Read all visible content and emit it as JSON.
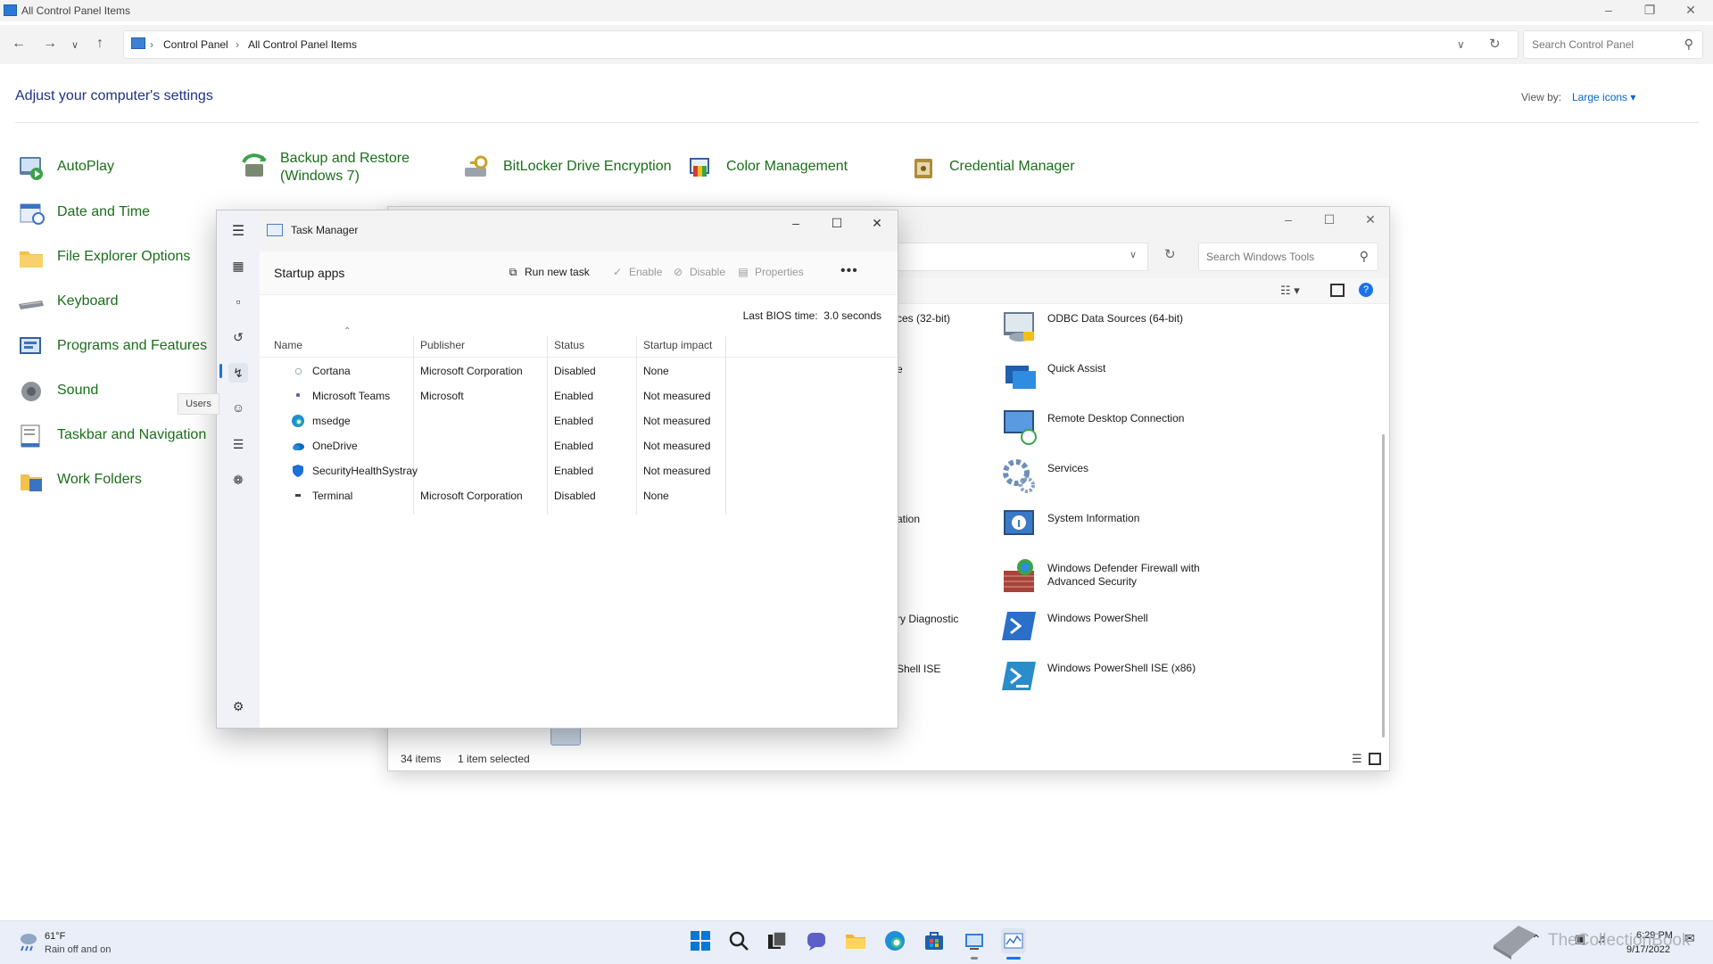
{
  "control_panel": {
    "window_title": "All Control Panel Items",
    "breadcrumb": [
      "Control Panel",
      "All Control Panel Items"
    ],
    "search_placeholder": "Search Control Panel",
    "heading": "Adjust your computer's settings",
    "view_by_label": "View by:",
    "view_by_value": "Large icons",
    "items": [
      {
        "label": "AutoPlay",
        "icon": "autoplay-icon"
      },
      {
        "label": "Backup and Restore (Windows 7)",
        "icon": "backup-icon"
      },
      {
        "label": "BitLocker Drive Encryption",
        "icon": "bitlocker-icon"
      },
      {
        "label": "Color Management",
        "icon": "color-management-icon"
      },
      {
        "label": "Credential Manager",
        "icon": "credential-manager-icon"
      },
      {
        "label": "Date and Time",
        "icon": "date-time-icon"
      },
      {
        "label": "File Explorer Options",
        "icon": "folder-options-icon"
      },
      {
        "label": "Keyboard",
        "icon": "keyboard-icon"
      },
      {
        "label": "Programs and Features",
        "icon": "programs-icon"
      },
      {
        "label": "Sound",
        "icon": "sound-icon"
      },
      {
        "label": "Taskbar and Navigation",
        "icon": "taskbar-icon"
      },
      {
        "label": "Work Folders",
        "icon": "work-folders-icon"
      }
    ]
  },
  "windows_tools": {
    "search_placeholder": "Search Windows Tools",
    "items": [
      {
        "label": "ODBC Data Sources (64-bit)",
        "icon": "odbc-icon"
      },
      {
        "label": "Quick Assist",
        "icon": "quick-assist-icon"
      },
      {
        "label": "Remote Desktop Connection",
        "icon": "remote-desktop-icon"
      },
      {
        "label": "Services",
        "icon": "services-icon"
      },
      {
        "label": "System Information",
        "icon": "system-info-icon"
      },
      {
        "label": "Windows Defender Firewall with Advanced Security",
        "icon": "firewall-icon"
      },
      {
        "label": "Windows PowerShell",
        "icon": "powershell-icon"
      },
      {
        "label": "Windows PowerShell ISE (x86)",
        "icon": "powershell-ise-icon"
      }
    ],
    "partial_left": [
      "ces (32-bit)",
      "e",
      "ation",
      "ry Diagnostic",
      "Shell ISE"
    ],
    "status_count": "34 items",
    "status_selected": "1 item selected"
  },
  "task_manager": {
    "title": "Task Manager",
    "page_title": "Startup apps",
    "toolbar": {
      "run_new_task": "Run new task",
      "enable": "Enable",
      "disable": "Disable",
      "properties": "Properties"
    },
    "bios_label": "Last BIOS time:",
    "bios_value": "3.0 seconds",
    "columns": [
      "Name",
      "Publisher",
      "Status",
      "Startup impact"
    ],
    "rows": [
      {
        "name": "Cortana",
        "publisher": "Microsoft Corporation",
        "status": "Disabled",
        "impact": "None"
      },
      {
        "name": "Microsoft Teams",
        "publisher": "Microsoft",
        "status": "Enabled",
        "impact": "Not measured"
      },
      {
        "name": "msedge",
        "publisher": "",
        "status": "Enabled",
        "impact": "Not measured"
      },
      {
        "name": "OneDrive",
        "publisher": "",
        "status": "Enabled",
        "impact": "Not measured"
      },
      {
        "name": "SecurityHealthSystray",
        "publisher": "",
        "status": "Enabled",
        "impact": "Not measured"
      },
      {
        "name": "Terminal",
        "publisher": "Microsoft Corporation",
        "status": "Disabled",
        "impact": "None"
      }
    ],
    "tooltip": "Users"
  },
  "taskbar": {
    "weather_temp": "61°F",
    "weather_desc": "Rain off and on",
    "time": "6:29 PM",
    "date": "9/17/2022",
    "watermark": "TheCollectionBook"
  }
}
